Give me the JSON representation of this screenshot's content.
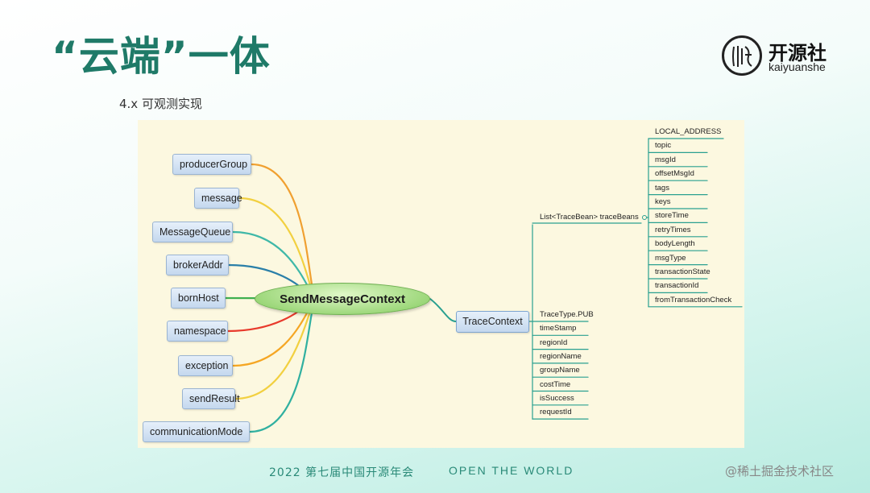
{
  "slide": {
    "title": "“云端”一体",
    "subtitle": "4.x  可观测实现"
  },
  "logo": {
    "name_cn": "开源社",
    "name_en": "kaiyuanshe"
  },
  "diagram": {
    "center": "SendMessageContext",
    "left_nodes": [
      {
        "label": "producerGroup",
        "color": "#f0a030"
      },
      {
        "label": "message",
        "color": "#f2d040"
      },
      {
        "label": "MessageQueue",
        "color": "#3fb8a8"
      },
      {
        "label": "brokerAddr",
        "color": "#2a7fa8"
      },
      {
        "label": "bornHost",
        "color": "#3fb050"
      },
      {
        "label": "namespace",
        "color": "#e83a2c"
      },
      {
        "label": "exception",
        "color": "#f5a623"
      },
      {
        "label": "sendResult",
        "color": "#f2d040"
      },
      {
        "label": "communicationMode",
        "color": "#30b0a0"
      }
    ],
    "trace_node": "TraceContext",
    "trace_beans_label": "List<TraceBean> traceBeans",
    "trace_fields": [
      "TraceType.PUB",
      "timeStamp",
      "regionId",
      "regionName",
      "groupName",
      "costTime",
      "isSuccess",
      "requestId"
    ],
    "bean_fields": [
      "LOCAL_ADDRESS",
      "topic",
      "msgId",
      "offsetMsgId",
      "tags",
      "keys",
      "storeTime",
      "retryTimes",
      "bodyLength",
      "msgType",
      "transactionState",
      "transactionId",
      "fromTransactionCheck"
    ],
    "line_color": "#2aa090"
  },
  "footer": {
    "year_text": "2022  第七届中国开源年会",
    "slogan": "OPEN  THE  WORLD"
  },
  "watermark": "@稀土掘金技术社区"
}
